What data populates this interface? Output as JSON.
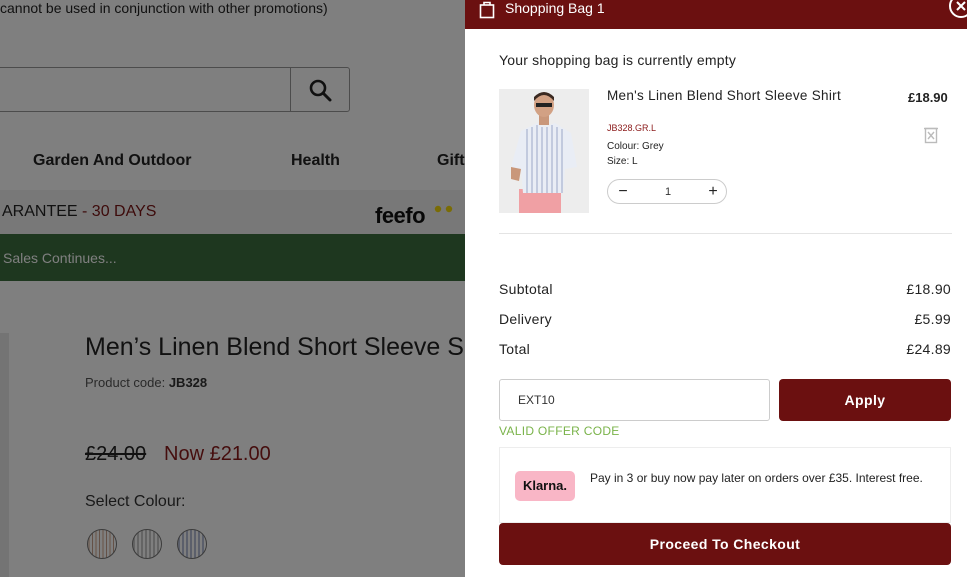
{
  "page": {
    "promo_banner": "cannot be used in conjunction with other promotions)",
    "nav": [
      "Garden And Outdoor",
      "Health",
      "Gift"
    ],
    "guarantee": {
      "text": "ARANTEE",
      "days": " - 30 DAYS"
    },
    "feefo_logo": "feefo",
    "sale_banner": "Sales Continues...",
    "product": {
      "title": "Men’s Linen Blend Short Sleeve S",
      "code_label": "Product code: ",
      "code": "JB328",
      "old_price": "£24.00",
      "new_price": "Now £21.00",
      "select_colour_label": "Select Colour:"
    }
  },
  "drawer": {
    "title": "Shopping Bag 1",
    "empty_message": "Your shopping bag is currently empty",
    "item": {
      "name": "Men's Linen Blend Short Sleeve Shirt",
      "price": "£18.90",
      "sku": "JB328.GR.L",
      "colour": "Colour: Grey",
      "size": "Size: L",
      "quantity": "1",
      "minus": "−",
      "plus": "+"
    },
    "summary": {
      "subtotal_label": "Subtotal",
      "subtotal": "£18.90",
      "delivery_label": "Delivery",
      "delivery": "£5.99",
      "total_label": "Total",
      "total": "£24.89"
    },
    "promo": {
      "code": "EXT10",
      "apply_label": "Apply",
      "status": "VALID OFFER CODE"
    },
    "klarna": {
      "badge": "Klarna.",
      "text": "Pay in 3 or buy now pay later on orders over £35. Interest free."
    },
    "checkout_label": "Proceed To Checkout"
  },
  "colors": {
    "brand": "#6b1010",
    "valid": "#7ab34a",
    "sale_bar": "#3c6e3f",
    "klarna_pink": "#f9b6c6"
  }
}
